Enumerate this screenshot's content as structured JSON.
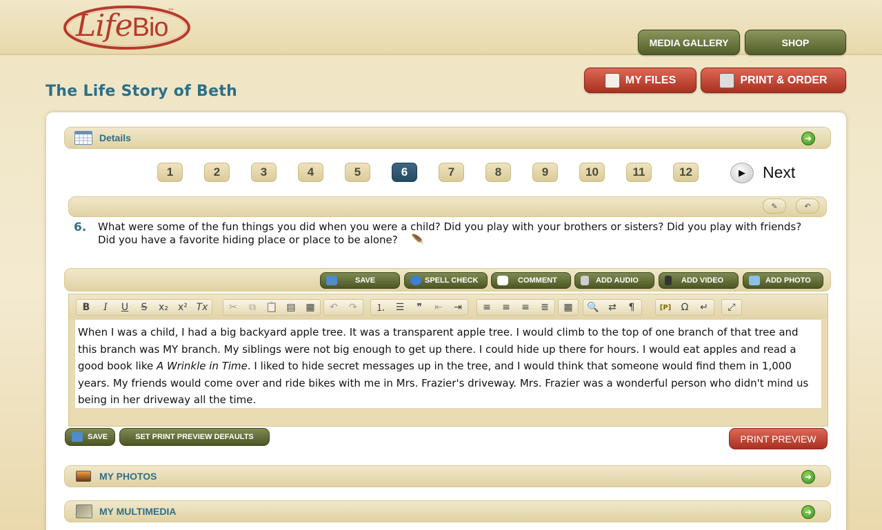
{
  "brand": {
    "name_script": "Life",
    "name_block": "Bio",
    "tm": "™"
  },
  "header": {
    "media_gallery": "MEDIA GALLERY",
    "shop": "SHOP",
    "my_files": "MY FILES",
    "print_order": "PRINT & ORDER"
  },
  "page_title": "The Life Story of Beth",
  "details": {
    "label": "Details"
  },
  "pagination": {
    "pages": [
      "1",
      "2",
      "3",
      "4",
      "5",
      "6",
      "7",
      "8",
      "9",
      "10",
      "11",
      "12"
    ],
    "current": "6",
    "next_label": "Next"
  },
  "question": {
    "number": "6.",
    "text": "What were some of the fun things you did when you were a child? Did you play with your brothers or sisters? Did you play with friends? Did you have a favorite hiding place or place to be alone?"
  },
  "actions": {
    "save": "SAVE",
    "spell_check": "SPELL CHECK",
    "comment": "COMMENT",
    "add_audio": "ADD AUDIO",
    "add_video": "ADD VIDEO",
    "add_photo": "ADD PHOTO"
  },
  "editor_toolbar": {
    "bold": "B",
    "italic": "I",
    "underline": "U",
    "strike": "S",
    "subscript": "x₂",
    "superscript": "x²",
    "remove_format": "Tx",
    "cut": "✂",
    "copy": "⧉",
    "paste": "📋",
    "paste_text": "▤",
    "paste_word": "▦",
    "undo": "↶",
    "redo": "↷",
    "numbered_list": "⒈",
    "bullet_list": "☰",
    "blockquote": "❞",
    "outdent": "⇤",
    "indent": "⇥",
    "align_left": "≡",
    "align_center": "≡",
    "align_right": "≡",
    "justify": "≣",
    "table": "▦",
    "find": "🔍",
    "replace": "⇄",
    "format": "¶",
    "placeholder": "[P]",
    "special_char": "Ω",
    "page_break": "↵",
    "maximize": "⤢"
  },
  "answer": {
    "part1": "When I was a child, I had a big backyard apple tree. It was a transparent apple tree. I would climb to the top of one branch of that tree and this branch was MY branch. My siblings were not big enough to get up there. I could hide up there for hours. I would eat apples and read a good book like ",
    "book_title": "A Wrinkle in Time",
    "part2": ". I liked to hide secret messages up in the tree, and I would think that someone would find them in 1,000 years. My friends would come over and ride bikes with me in Mrs. Frazier's driveway. Mrs. Frazier was a wonderful person who didn't mind us being in her driveway all the time."
  },
  "footer_actions": {
    "save": "SAVE",
    "set_defaults": "SET PRINT PREVIEW DEFAULTS",
    "print_preview": "PRINT PREVIEW"
  },
  "sections": {
    "my_photos": "MY PHOTOS",
    "my_multimedia": "MY MULTIMEDIA"
  },
  "colors": {
    "accent_blue": "#2d6f88",
    "button_green": "#535e28",
    "button_red": "#a8301f",
    "active_page": "#244a64"
  }
}
